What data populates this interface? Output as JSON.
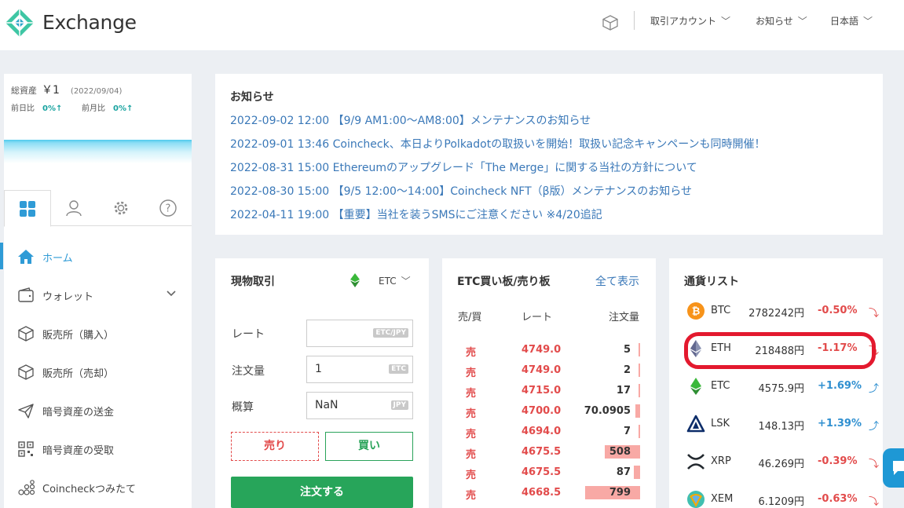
{
  "header": {
    "brand": "Exchange",
    "menus": [
      "取引アカウント",
      "お知らせ",
      "日本語"
    ]
  },
  "sidebar": {
    "asset_label": "総資産",
    "asset_value": "￥1",
    "asset_date": "(2022/09/04)",
    "day_label": "前日比",
    "day_value": "0%↑",
    "month_label": "前月比",
    "month_value": "0%↑",
    "nav": [
      {
        "label": "ホーム",
        "icon": "home-icon"
      },
      {
        "label": "ウォレット",
        "icon": "wallet-icon"
      },
      {
        "label": "販売所（購入）",
        "icon": "box-icon"
      },
      {
        "label": "販売所（売却）",
        "icon": "box-icon"
      },
      {
        "label": "暗号資産の送金",
        "icon": "send-icon"
      },
      {
        "label": "暗号資産の受取",
        "icon": "qr-icon"
      },
      {
        "label": "Coincheckつみたて",
        "icon": "coins-icon"
      }
    ]
  },
  "news": {
    "title": "お知らせ",
    "items": [
      "2022-09-02 12:00 【9/9 AM1:00～AM8:00】メンテナンスのお知らせ",
      "2022-09-01 13:46 Coincheck、本日よりPolkadotの取扱いを開始！取扱い記念キャンペーンも同時開催！",
      "2022-08-31 15:00 Ethereumのアップグレード「The Merge」に関する当社の方針について",
      "2022-08-30 15:00 【9/5 12:00～14:00】Coincheck NFT（β版）メンテナンスのお知らせ",
      "2022-04-11 19:00 【重要】当社を装うSMSにご注意ください ※4/20追記"
    ]
  },
  "trade": {
    "title": "現物取引",
    "pair": "ETC",
    "rate_label": "レート",
    "rate_unit": "ETC/JPY",
    "amount_label": "注文量",
    "amount_value": "1",
    "amount_unit": "ETC",
    "estimate_label": "概算",
    "estimate_value": "NaN",
    "estimate_unit": "JPY",
    "sell_label": "売り",
    "buy_label": "買い",
    "order_label": "注文する"
  },
  "orderbook": {
    "title": "ETC買い板/売り板",
    "show_all": "全て表示",
    "headers": [
      "売/買",
      "レート",
      "注文量"
    ],
    "rows": [
      {
        "side": "売",
        "rate": "4749.0",
        "qty": "5",
        "depth": 0.02
      },
      {
        "side": "売",
        "rate": "4749.0",
        "qty": "2",
        "depth": 0.02
      },
      {
        "side": "売",
        "rate": "4715.0",
        "qty": "17",
        "depth": 0.02
      },
      {
        "side": "売",
        "rate": "4700.0",
        "qty": "70.0905",
        "depth": 0.09
      },
      {
        "side": "売",
        "rate": "4694.0",
        "qty": "7",
        "depth": 0.02
      },
      {
        "side": "売",
        "rate": "4675.5",
        "qty": "508",
        "depth": 0.64
      },
      {
        "side": "売",
        "rate": "4675.5",
        "qty": "87",
        "depth": 0.11
      },
      {
        "side": "売",
        "rate": "4668.5",
        "qty": "799",
        "depth": 1.0
      }
    ]
  },
  "currencies": {
    "title": "通貨リスト",
    "items": [
      {
        "code": "BTC",
        "price": "2782242円",
        "change": "-0.50%",
        "dir": "down",
        "icon": "btc-icon",
        "color": "#f7931a"
      },
      {
        "code": "ETH",
        "price": "218488円",
        "change": "-1.17%",
        "dir": "down",
        "icon": "eth-icon",
        "color": "#627eea"
      },
      {
        "code": "ETC",
        "price": "4575.9円",
        "change": "+1.69%",
        "dir": "up",
        "icon": "etc-icon",
        "color": "#3ab83a"
      },
      {
        "code": "LSK",
        "price": "148.13円",
        "change": "+1.39%",
        "dir": "up",
        "icon": "lsk-icon",
        "color": "#0d2d69"
      },
      {
        "code": "XRP",
        "price": "46.269円",
        "change": "-0.39%",
        "dir": "down",
        "icon": "xrp-icon",
        "color": "#23292f"
      },
      {
        "code": "XEM",
        "price": "6.1209円",
        "change": "-0.63%",
        "dir": "down",
        "icon": "xem-icon",
        "color": "#41bfb0"
      }
    ]
  },
  "colors": {
    "accent": "#2f9bd6",
    "sell": "#e24b4b",
    "buy": "#27a55a",
    "highlight": "#e3192e"
  }
}
